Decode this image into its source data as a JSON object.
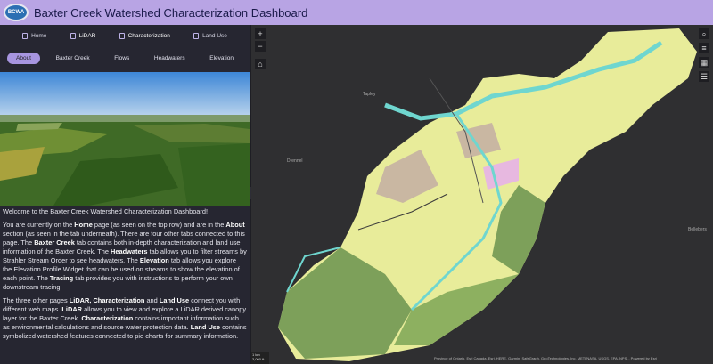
{
  "header": {
    "logo_text": "BCWA",
    "title": "Baxter Creek Watershed Characterization Dashboard"
  },
  "top_tabs": [
    "Home",
    "LiDAR",
    "Characterization",
    "Land Use"
  ],
  "sub_tabs": [
    "About",
    "Baxter Creek",
    "Flows",
    "Headwaters",
    "Elevation"
  ],
  "content": {
    "welcome": "Welcome to the Baxter Creek Watershed Characterization Dashboard!",
    "p1": [
      {
        "t": "You are currently on the "
      },
      {
        "b": "Home"
      },
      {
        "t": " page (as seen on the top row) and are in the "
      },
      {
        "b": "About"
      },
      {
        "t": " section (as seen in the tab underneath). There are four other tabs connected to this page. The "
      },
      {
        "b": "Baxter Creek"
      },
      {
        "t": " tab contains both in-depth characterization and land use information of the Baxter Creek. The "
      },
      {
        "b": "Headwaters"
      },
      {
        "t": " tab allows you to filter streams by Strahler Stream Order to see headwaters. The "
      },
      {
        "b": "Elevation"
      },
      {
        "t": " tab allows you explore the Elevation Profile Widget that can be used on streams to show the elevation of each point. The "
      },
      {
        "b": "Tracing"
      },
      {
        "t": " tab provides you with instructions to perform your own downstream tracing."
      }
    ],
    "p2": [
      {
        "t": "The three other pages "
      },
      {
        "b": "LiDAR, Characterization"
      },
      {
        "t": " and "
      },
      {
        "b": "Land Use"
      },
      {
        "t": " connect you with different web maps. "
      },
      {
        "b": "LiDAR"
      },
      {
        "t": " allows you to view and explore a LiDAR derived canopy layer for the Baxter Creek. "
      },
      {
        "b": "Characterization"
      },
      {
        "t": " contains important information such as environmental calculations and source water protection data. "
      },
      {
        "b": "Land Use"
      },
      {
        "t": " contains symbolized watershed features connected to pie charts for summary information."
      }
    ]
  },
  "map": {
    "places": [
      "Tapley",
      "Drennel",
      "Bellebers"
    ],
    "scale": "1 km",
    "scale_sub": "3,000 ft",
    "attribution": "Province of Ontario, Esri Canada, Esri, HERE, Garmin, SafeGraph, GeoTechnologies, Inc, METI/NASA, USGS, EPA, NPS...   Powered by Esri",
    "buttons": {
      "zoom_in": "+",
      "zoom_out": "−",
      "home": "⌂",
      "search": "⌕",
      "layers": "≡",
      "basemap": "▦",
      "legend": "☰"
    }
  },
  "colors": {
    "header": "#b8a4e4",
    "panel": "#262631",
    "accent": "#a795e0"
  }
}
